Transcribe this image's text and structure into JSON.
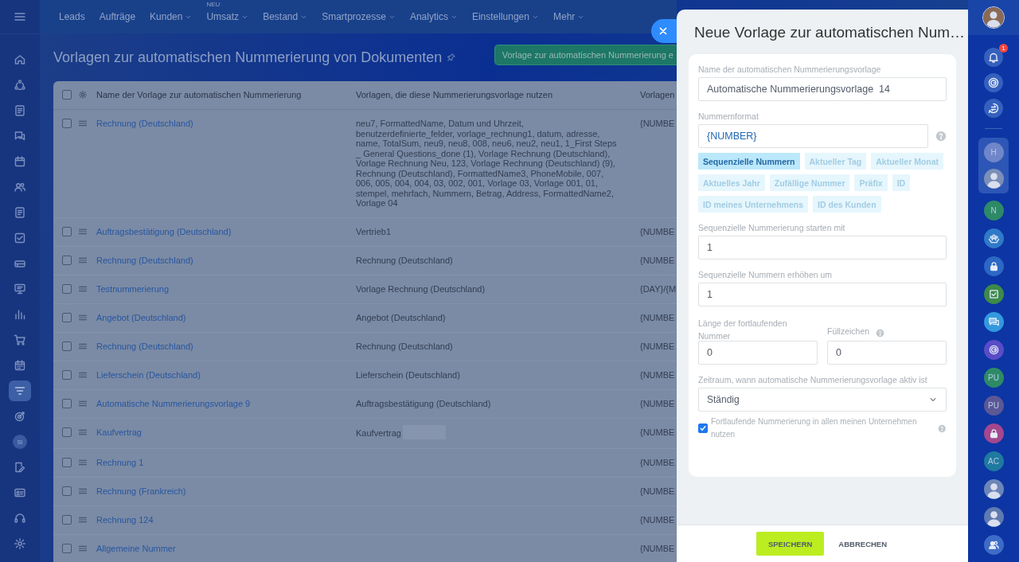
{
  "left_sidebar": {
    "items": [
      {
        "kind": "icon",
        "selected": false
      },
      {
        "kind": "icon",
        "selected": false
      },
      {
        "kind": "icon",
        "selected": false
      },
      {
        "kind": "icon",
        "selected": false
      },
      {
        "kind": "icon",
        "selected": false
      },
      {
        "kind": "icon",
        "selected": false
      },
      {
        "kind": "icon",
        "selected": false
      },
      {
        "kind": "icon",
        "selected": false
      },
      {
        "kind": "icon",
        "selected": false
      },
      {
        "kind": "icon",
        "selected": false
      },
      {
        "kind": "icon",
        "selected": false
      },
      {
        "kind": "icon",
        "selected": false
      },
      {
        "kind": "icon",
        "selected": false
      },
      {
        "kind": "icon",
        "selected": true
      },
      {
        "kind": "icon",
        "selected": false
      },
      {
        "kind": "letter",
        "label": "SI",
        "selected": false
      },
      {
        "kind": "icon",
        "selected": false
      },
      {
        "kind": "icon",
        "selected": false
      },
      {
        "kind": "icon",
        "selected": false
      },
      {
        "kind": "icon",
        "selected": false
      }
    ]
  },
  "top_nav": {
    "items": [
      {
        "label": "Leads",
        "dropdown": false
      },
      {
        "label": "Aufträge",
        "dropdown": false
      },
      {
        "label": "Kunden",
        "dropdown": true
      },
      {
        "label": "Umsatz",
        "dropdown": true,
        "badge": "NEU"
      },
      {
        "label": "Bestand",
        "dropdown": true
      },
      {
        "label": "Smartprozesse",
        "dropdown": true
      },
      {
        "label": "Analytics",
        "dropdown": true
      },
      {
        "label": "Einstellungen",
        "dropdown": true
      },
      {
        "label": "Mehr",
        "dropdown": true
      }
    ]
  },
  "page": {
    "title": "Vorlagen zur automatischen Nummerierung von Dokumenten",
    "action_button": "Vorlage zur automatischen Nummerierung e"
  },
  "table": {
    "header_checked": false,
    "columns": [
      "Name der Vorlage zur automatischen Nummerierung",
      "Vorlagen, die diese Nummerierungsvorlage nutzen",
      "Vorlagen"
    ],
    "rows": [
      {
        "checked": false,
        "name": "Rechnung (Deutschland)",
        "templates": "neu7, FormattedName, Datum und Uhrzeit, benutzerdefinierte_felder, vorlage_rechnung1, datum, adresse, name, TotalSum, neu9, neu8, 008, neu6, neu2, neu1, 1_First Steps _ General Questions_done (1), Vorlage Rechnung (Deutschland), Vorlage Rechnung Neu, 123, Vorlage Rechnung (Deutschland) (9), Rechnung (Deutschland), FormattedName3, PhoneMobile, 007, 006, 005, 004, 004, 03, 002, 001, Vorlage 03, Vorlage 001, 01, stempel, mehrfach, Nummern, Betrag, Address, FormattedName2, Vorlage 04",
        "column_3": "{NUMBE"
      },
      {
        "checked": false,
        "name": "Auftragsbestätigung (Deutschland)",
        "templates": "Vertrieb1",
        "column_3": "{NUMBE"
      },
      {
        "checked": false,
        "name": "Rechnung (Deutschland)",
        "templates": "Rechnung (Deutschland)",
        "column_3": "{NUMBE"
      },
      {
        "checked": false,
        "name": "Testnummerierung",
        "templates": "Vorlage Rechnung (Deutschland)",
        "column_3": "{DAY}/{M"
      },
      {
        "checked": false,
        "name": "Angebot (Deutschland)",
        "templates": "Angebot (Deutschland)",
        "column_3": "{NUMBE"
      },
      {
        "checked": false,
        "name": "Rechnung (Deutschland)",
        "templates": "Rechnung (Deutschland)",
        "column_3": "{NUMBE"
      },
      {
        "checked": false,
        "name": "Lieferschein (Deutschland)",
        "templates": "Lieferschein (Deutschland)",
        "column_3": "{NUMBE"
      },
      {
        "checked": false,
        "name": "Automatische Nummerierungsvorlage 9",
        "templates": "Auftragsbestätigung (Deutschland)",
        "column_3": "{NUMBE"
      },
      {
        "checked": false,
        "name": "Kaufvertrag",
        "templates": "Kaufvertrag",
        "redacted": true,
        "column_3": "{NUMBE"
      },
      {
        "checked": false,
        "name": "Rechnung 1",
        "column_3": "{NUMBE"
      },
      {
        "checked": false,
        "name": "Rechnung (Frankreich)",
        "column_3": "{NUMBE"
      },
      {
        "checked": false,
        "name": "Rechnung 124",
        "column_3": "{NUMBE"
      },
      {
        "checked": false,
        "name": "Allgemeine Nummer",
        "column_3": "{NUMBE"
      }
    ]
  },
  "panel": {
    "title": "Neue Vorlage zur automatischen Num…",
    "name_label": "Name der automatischen Nummerierungsvorlage",
    "name_value": "Automatische Nummerierungsvorlage  14",
    "format_label": "Nummernformat",
    "format_value": "{NUMBER}",
    "chips": [
      {
        "label": "Sequenzielle Nummern",
        "selected": true
      },
      {
        "label": "Aktueller Tag",
        "selected": false
      },
      {
        "label": "Aktueller Monat",
        "selected": false
      },
      {
        "label": "Aktuelles Jahr",
        "selected": false
      },
      {
        "label": "Zufällige Nummer",
        "selected": false
      },
      {
        "label": "Präfix",
        "selected": false
      },
      {
        "label": "ID",
        "selected": false
      },
      {
        "label": "ID meines Unternehmens",
        "selected": false
      },
      {
        "label": "ID des Kunden",
        "selected": false
      }
    ],
    "start_label": "Sequenzielle Nummerierung starten mit",
    "start_value": "1",
    "step_label": "Sequenzielle Nummern erhöhen um",
    "step_value": "1",
    "length_label": "Länge der fortlaufenden Nummer",
    "length_value": "0",
    "fill_label": "Füllzeichen",
    "fill_value": "0",
    "period_label": "Zeitraum, wann automatische Nummerierungsvorlage aktiv ist",
    "period_value": "Ständig",
    "shared": {
      "label": "Fortlaufende Nummerierung in allen meinen Unternehmen nutzen",
      "checked": true
    },
    "buttons": [
      {
        "label": "SPEICHERN",
        "kind": "primary"
      },
      {
        "label": "ABBRECHEN",
        "kind": "link"
      }
    ]
  },
  "right_sidebar": {
    "notification_badge": "1",
    "pinned": [
      {
        "kind": "letter",
        "label": "H",
        "color": "#6f86c9"
      },
      {
        "kind": "photo",
        "color": "#7c8fb8"
      }
    ],
    "items": [
      {
        "kind": "letter",
        "label": "N",
        "color": "#2e8a66"
      },
      {
        "kind": "icon",
        "color": "#2f7ac9"
      },
      {
        "kind": "icon",
        "color": "#2c68c4"
      },
      {
        "kind": "icon",
        "color": "#3d8a4a"
      },
      {
        "kind": "icon",
        "color": "#3399de"
      },
      {
        "kind": "icon",
        "color": "#5a4cc6"
      },
      {
        "kind": "letter",
        "label": "PU",
        "color": "#2e8a66"
      },
      {
        "kind": "letter",
        "label": "PU",
        "color": "#5b5895"
      },
      {
        "kind": "icon",
        "color": "#a4478e"
      },
      {
        "kind": "letter",
        "label": "AC",
        "color": "#1f7aa0"
      },
      {
        "kind": "photo",
        "color": "#6d86b8"
      },
      {
        "kind": "photo",
        "color": "#5f7ab0"
      },
      {
        "kind": "icon",
        "color": "#3d6cc7"
      }
    ]
  }
}
